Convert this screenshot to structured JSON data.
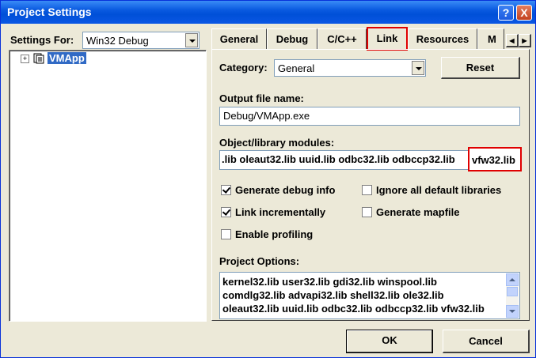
{
  "window": {
    "title": "Project Settings",
    "help_label": "?",
    "close_label": "X"
  },
  "settings_for": {
    "label": "Settings For:",
    "value": "Win32 Debug"
  },
  "tree": {
    "project": "VMApp",
    "expander": "+"
  },
  "tabs": [
    {
      "label": "General"
    },
    {
      "label": "Debug"
    },
    {
      "label": "C/C++"
    },
    {
      "label": "Link"
    },
    {
      "label": "Resources"
    },
    {
      "label": "M"
    }
  ],
  "tab_scroll": {
    "left": "◀",
    "right": "▶"
  },
  "category": {
    "label": "Category:",
    "value": "General"
  },
  "reset_label": "Reset",
  "output_file": {
    "label": "Output file name:",
    "value": "Debug/VMApp.exe"
  },
  "object_modules": {
    "label": "Object/library modules:",
    "value": ".lib oleaut32.lib uuid.lib odbc32.lib odbccp32.lib",
    "highlight": "vfw32.lib"
  },
  "checkboxes": {
    "generate_debug_info": {
      "label": "Generate debug info",
      "checked": true
    },
    "ignore_default_libs": {
      "label": "Ignore all default libraries",
      "checked": false
    },
    "link_incrementally": {
      "label": "Link incrementally",
      "checked": true
    },
    "generate_mapfile": {
      "label": "Generate mapfile",
      "checked": false
    },
    "enable_profiling": {
      "label": "Enable profiling",
      "checked": false
    }
  },
  "project_options": {
    "label": "Project Options:",
    "lines": [
      "kernel32.lib user32.lib gdi32.lib winspool.lib",
      "comdlg32.lib advapi32.lib shell32.lib ole32.lib",
      "oleaut32.lib uuid.lib odbc32.lib odbccp32.lib  vfw32.lib"
    ]
  },
  "footer": {
    "ok_label": "OK",
    "cancel_label": "Cancel"
  },
  "colors": {
    "titlebar": "#0a5ae0",
    "face": "#ece9d8",
    "highlight": "#e00000",
    "selection": "#316ac5"
  }
}
